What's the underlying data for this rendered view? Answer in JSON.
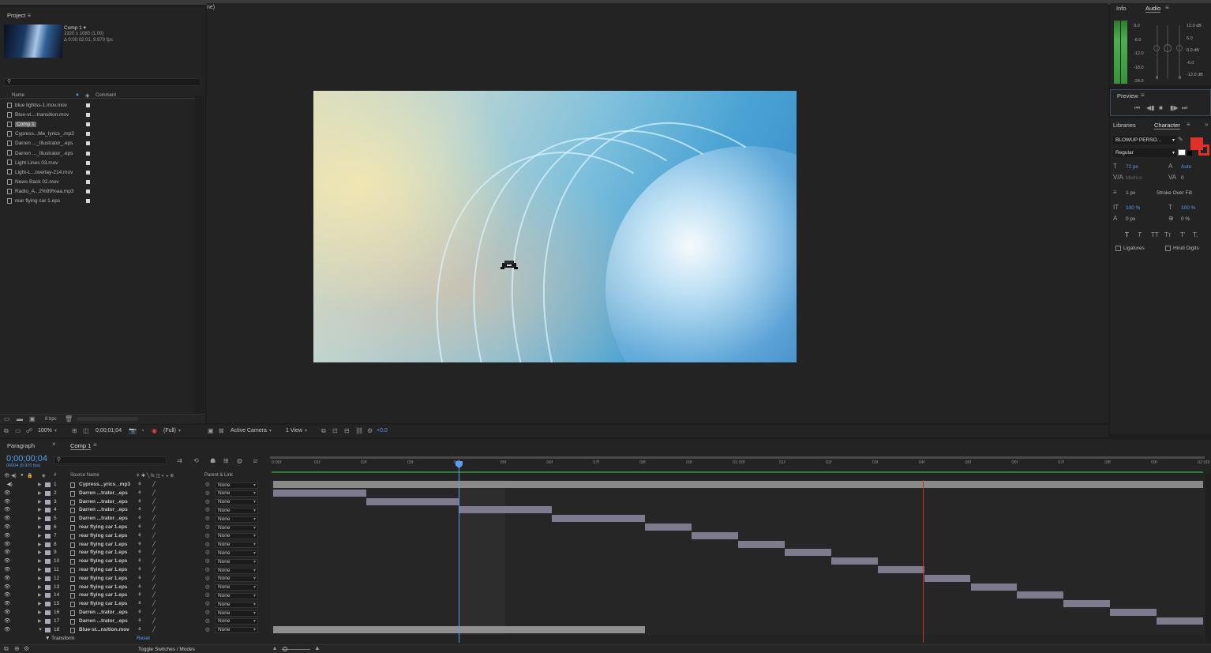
{
  "app": {
    "top_fragment": "ne)"
  },
  "project": {
    "tab": "Project",
    "comp_name": "Comp 1 ▾",
    "comp_res": "1920 x 1080 (1.00)",
    "comp_dur": "Δ 0;00;02;01, 9.970 fps",
    "search_placeholder": "",
    "col_name": "Name",
    "col_comment": "Comment",
    "items": [
      {
        "name": "blue lightss-1.mov.mov"
      },
      {
        "name": "Blue-st...-transition.mov"
      },
      {
        "name": "Comp 1"
      },
      {
        "name": "Cypress...Me_lyrics_.mp3"
      },
      {
        "name": "Darren ..._Illustrator_.eps"
      },
      {
        "name": "Darren ..._Illustrator_.eps"
      },
      {
        "name": "Light Lines 03.mov"
      },
      {
        "name": "Light-L...overlay-214.mov"
      },
      {
        "name": "News Back 02.mov"
      },
      {
        "name": "Radio_A...2%99%aa.mp3"
      },
      {
        "name": "rear flying car 1.eps"
      }
    ],
    "bpc": "8 bpc"
  },
  "viewer": {
    "zoom": "100%",
    "timecode": "0;00;01;04",
    "resolution": "(Full)",
    "camera": "Active Camera",
    "views": "1 View",
    "exposure": "+0.0"
  },
  "audio": {
    "tab_info": "Info",
    "tab_audio": "Audio",
    "left_scale": [
      "0.0",
      "-6.0",
      "-12.0",
      "-18.0",
      "-24.0"
    ],
    "right_scale": [
      "12.0 dB",
      "6.0",
      "0.0 dB",
      "-6.0",
      "-12.0 dB"
    ],
    "bottom_vals": [
      "0",
      "0"
    ]
  },
  "preview": {
    "tab": "Preview"
  },
  "character": {
    "tab_libraries": "Libraries",
    "tab_character": "Character",
    "font": "BLOWUP PERSO...",
    "style": "Regular",
    "size": "72 px",
    "leading": "Auto",
    "kerning": "Metrics",
    "tracking": "0",
    "stroke_width": "1 px",
    "stroke_mode": "Stroke Over Fill",
    "vscale": "100 %",
    "hscale": "100 %",
    "baseline": "0 px",
    "tsume": "0 %",
    "ligatures": "Ligatures",
    "hindi": "Hindi Digits",
    "fill_color": "#e0302a"
  },
  "timeline": {
    "tab_paragraph": "Paragraph",
    "tab_comp": "Comp 1",
    "timecode": "0;00;00;04",
    "frame_info": "00004 (9.970 fps)",
    "col_source": "Source Name",
    "col_parent": "Parent & Link",
    "transform": "Transform",
    "reset": "Reset",
    "toggle": "Toggle Switches / Modes",
    "ruler": [
      "0:00f",
      "01f",
      "02f",
      "03f",
      "04f",
      "05f",
      "06f",
      "07f",
      "08f",
      "09f",
      "01:00f",
      "01f",
      "02f",
      "03f",
      "04f",
      "05f",
      "06f",
      "07f",
      "08f",
      "09f",
      "02:00f"
    ],
    "layers": [
      {
        "num": "1",
        "name": "Cypress...yrics_.mp3",
        "parent": "None",
        "start": 0,
        "end": 20
      },
      {
        "num": "2",
        "name": "Darren ...trator_.eps",
        "parent": "None",
        "start": 0,
        "end": 2
      },
      {
        "num": "3",
        "name": "Darren ...trator_.eps",
        "parent": "None",
        "start": 2,
        "end": 4
      },
      {
        "num": "4",
        "name": "Darren ...trator_.eps",
        "parent": "None",
        "start": 4,
        "end": 6
      },
      {
        "num": "5",
        "name": "Darren ...trator_.eps",
        "parent": "None",
        "start": 6,
        "end": 8
      },
      {
        "num": "6",
        "name": "rear flying car 1.eps",
        "parent": "None",
        "start": 8,
        "end": 9
      },
      {
        "num": "7",
        "name": "rear flying car 1.eps",
        "parent": "None",
        "start": 9,
        "end": 10
      },
      {
        "num": "8",
        "name": "rear flying car 1.eps",
        "parent": "None",
        "start": 10,
        "end": 11
      },
      {
        "num": "9",
        "name": "rear flying car 1.eps",
        "parent": "None",
        "start": 11,
        "end": 12
      },
      {
        "num": "10",
        "name": "rear flying car 1.eps",
        "parent": "None",
        "start": 12,
        "end": 13
      },
      {
        "num": "11",
        "name": "rear flying car 1.eps",
        "parent": "None",
        "start": 13,
        "end": 14
      },
      {
        "num": "12",
        "name": "rear flying car 1.eps",
        "parent": "None",
        "start": 14,
        "end": 15
      },
      {
        "num": "13",
        "name": "rear flying car 1.eps",
        "parent": "None",
        "start": 15,
        "end": 16
      },
      {
        "num": "14",
        "name": "rear flying car 1.eps",
        "parent": "None",
        "start": 16,
        "end": 17
      },
      {
        "num": "15",
        "name": "rear flying car 1.eps",
        "parent": "None",
        "start": 17,
        "end": 18
      },
      {
        "num": "16",
        "name": "Darren ...trator_.eps",
        "parent": "None",
        "start": 18,
        "end": 19
      },
      {
        "num": "17",
        "name": "Darren ...trator_.eps",
        "parent": "None",
        "start": 19,
        "end": 20
      },
      {
        "num": "18",
        "name": "Blue-st...nsition.mov",
        "parent": "None",
        "start": 0,
        "end": 8
      }
    ]
  },
  "colors": {
    "accent": "#4a90e2",
    "playhead": "#5a9df0",
    "out_marker": "#c0392b",
    "bar": "#7d7b8d",
    "audio_bar": "#8a8a8a"
  }
}
